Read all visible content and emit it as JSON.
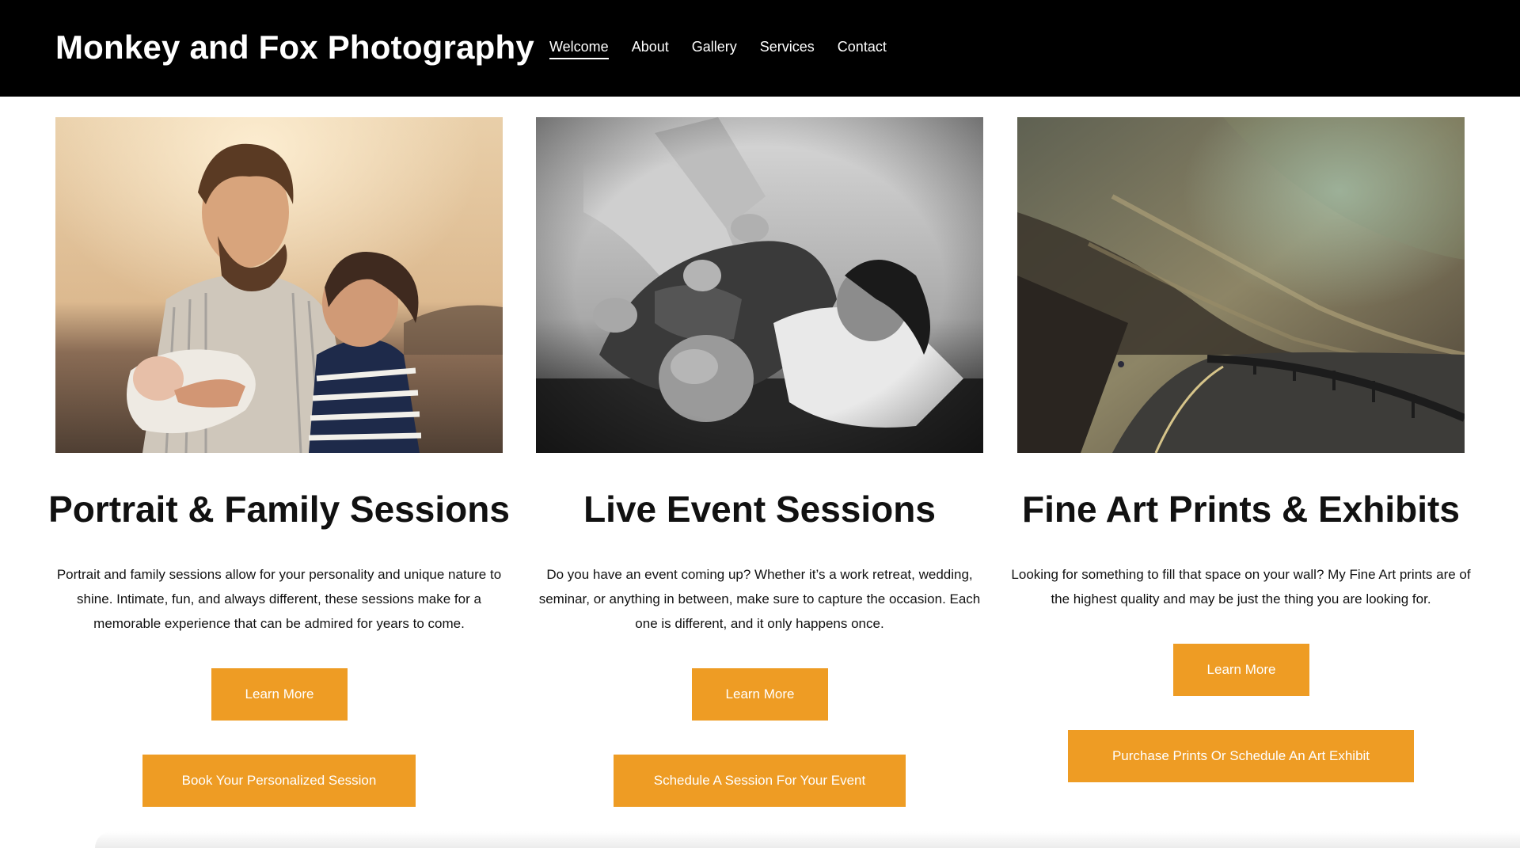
{
  "header": {
    "site_title": "Monkey and Fox Photography",
    "nav": [
      {
        "label": "Welcome",
        "active": true
      },
      {
        "label": "About",
        "active": false
      },
      {
        "label": "Gallery",
        "active": false
      },
      {
        "label": "Services",
        "active": false
      },
      {
        "label": "Contact",
        "active": false
      }
    ]
  },
  "sections": [
    {
      "photo": "portrait-family-photo",
      "heading": "Portrait & Family Sessions",
      "description": "Portrait and family sessions allow for your personality and unique nature to shine. Intimate, fun, and always different, these sessions make for a memorable experience that can be admired for years to come.",
      "learn_more": "Learn More",
      "cta": "Book Your Personalized Session"
    },
    {
      "photo": "live-event-photo",
      "heading": "Live Event Sessions",
      "description": "Do you have an event coming up? Whether it’s a work retreat, wedding, seminar, or anything in between, make sure to capture the occasion. Each one is different, and it only happens once.",
      "learn_more": "Learn More",
      "cta": "Schedule A Session For Your Event"
    },
    {
      "photo": "fine-art-landscape-photo",
      "heading": "Fine Art Prints & Exhibits",
      "description": "Looking for something to fill that space on your wall? My Fine Art prints are of the highest quality and may be just the thing you are looking for.",
      "learn_more": "Learn More",
      "cta": "Purchase Prints Or Schedule An Art Exhibit"
    }
  ],
  "colors": {
    "header_bg": "#000000",
    "button_bg": "#ee9c24",
    "button_text": "#ffffff"
  }
}
